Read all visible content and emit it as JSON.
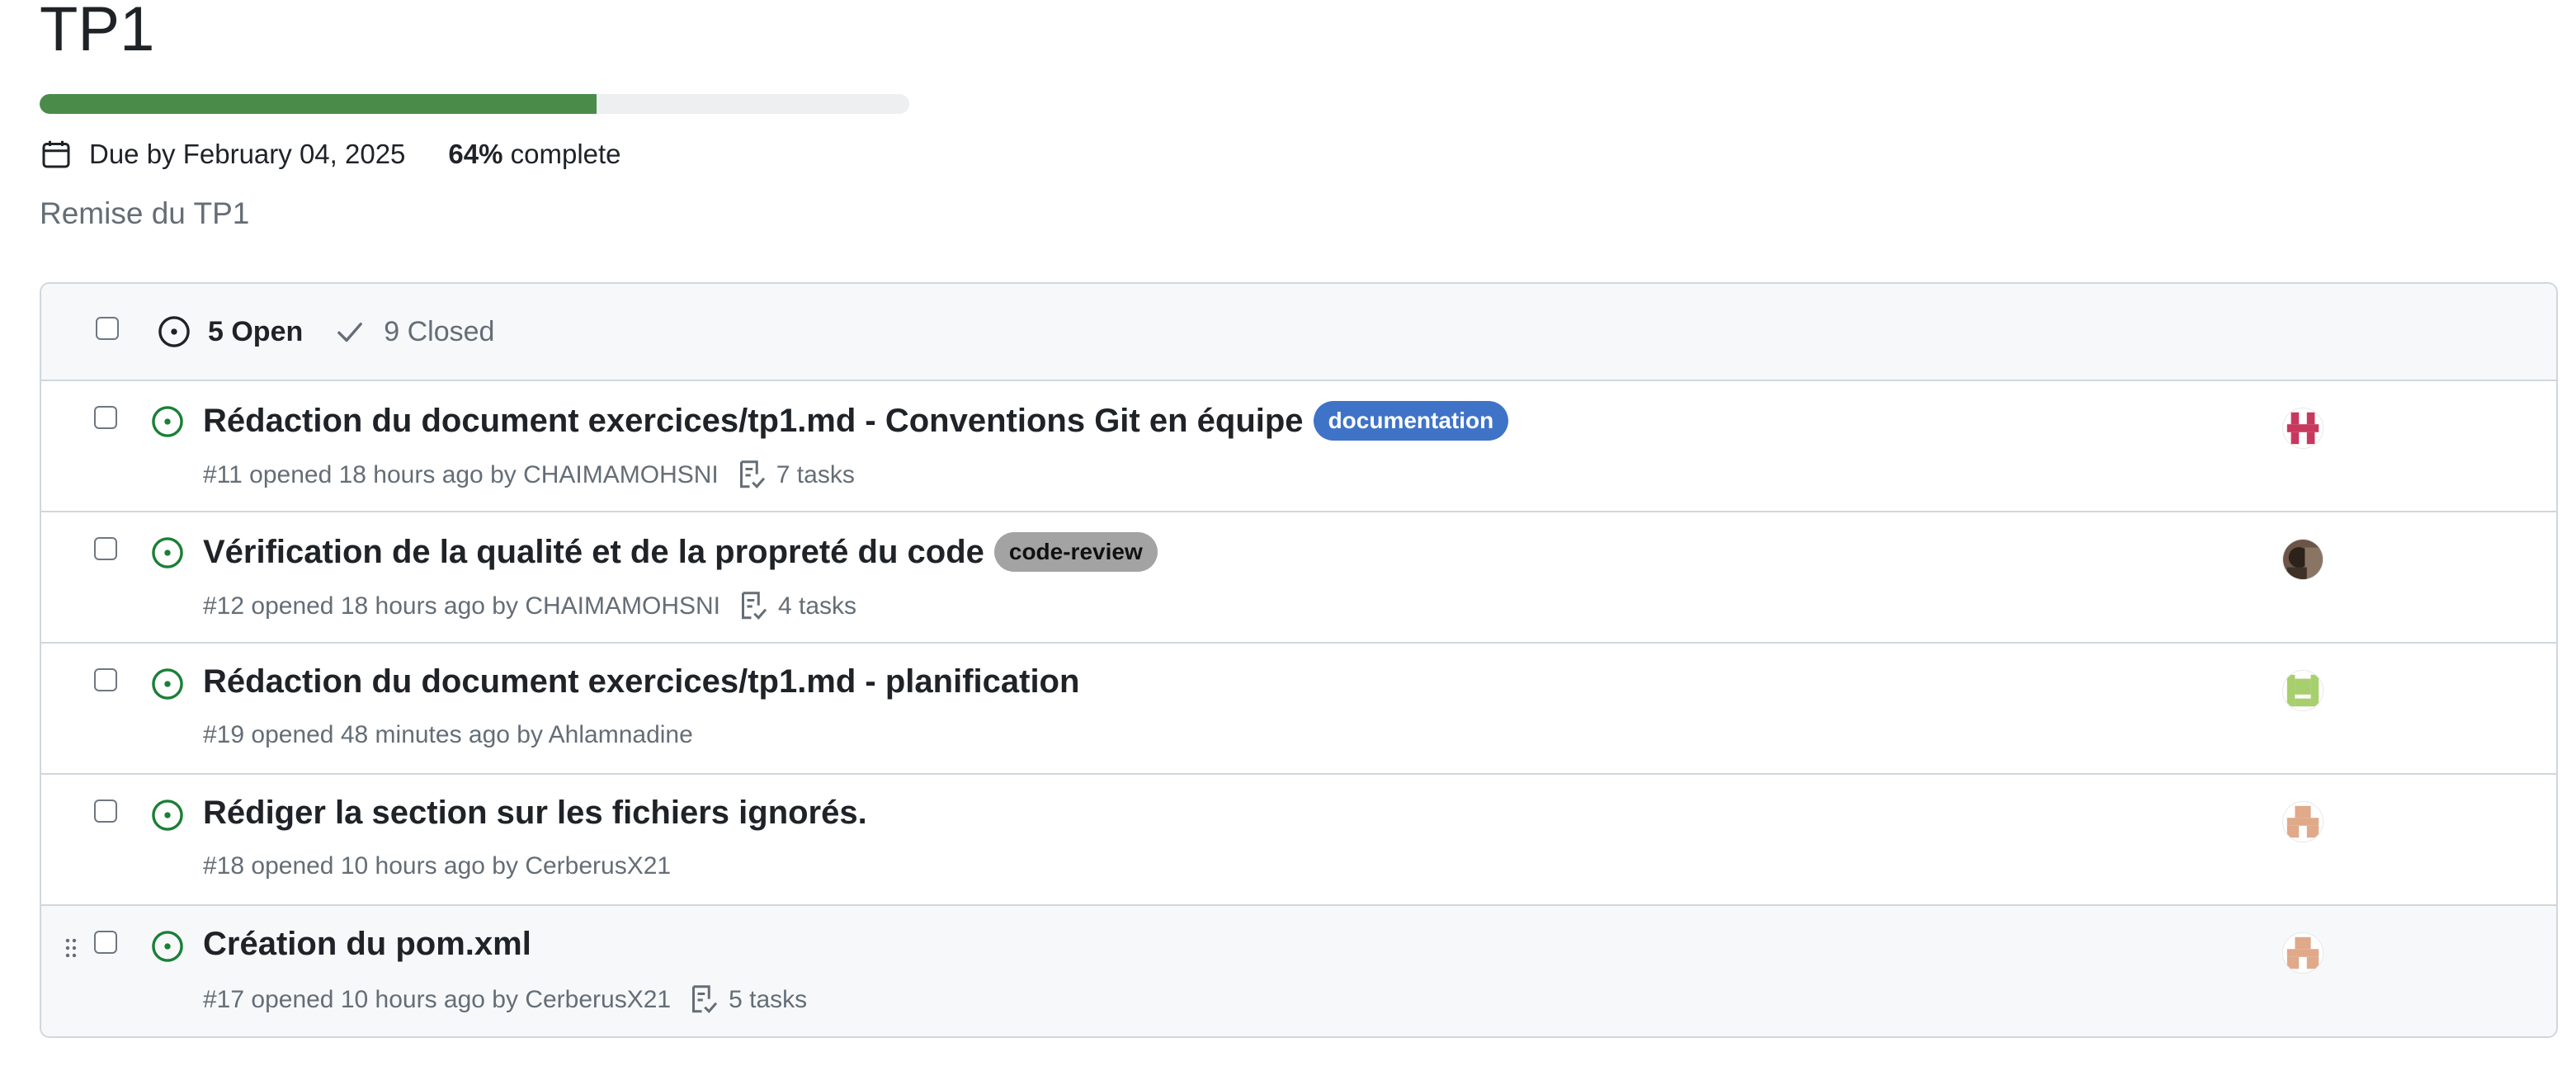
{
  "milestone": {
    "title": "TP1",
    "progress_percent": 64,
    "due_text": "Due by February 04, 2025",
    "percent_text": "64%",
    "complete_text": " complete",
    "description": "Remise du TP1"
  },
  "filters": {
    "open_label": "5 Open",
    "closed_label": "9 Closed"
  },
  "issues": [
    {
      "title": "Rédaction du document exercices/tp1.md - Conventions Git en équipe",
      "label": "documentation",
      "meta": "#11 opened 18 hours ago by CHAIMAMOHSNI",
      "tasks": "7 tasks",
      "avatar_color": "#c8385e"
    },
    {
      "title": "Vérification de la qualité et de la propreté du code",
      "label": "code-review",
      "meta": "#12 opened 18 hours ago by CHAIMAMOHSNI",
      "tasks": "4 tasks",
      "avatar_color": "#4a3a2c"
    },
    {
      "title": "Rédaction du document exercices/tp1.md - planification",
      "meta": "#19 opened 48 minutes ago by Ahlamnadine",
      "avatar_color": "#a7cf6e"
    },
    {
      "title": "Rédiger la section sur les fichiers ignorés.",
      "meta": "#18 opened 10 hours ago by CerberusX21",
      "avatar_color": "#e0a98a"
    },
    {
      "title": "Création du pom.xml",
      "meta": "#17 opened 10 hours ago by CerberusX21",
      "tasks": "5 tasks",
      "avatar_color": "#e0a98a"
    }
  ],
  "colors": {
    "open_issue": "#1a7f37",
    "progress": "#4a8b49",
    "label_documentation": "#3f73c8",
    "label_code_review": "#a3a3a3"
  },
  "icons": {
    "due": "calendar-icon",
    "open": "issue-opened-icon",
    "closed": "check-icon",
    "tasks": "tasklist-icon",
    "drag": "grabber-icon"
  }
}
